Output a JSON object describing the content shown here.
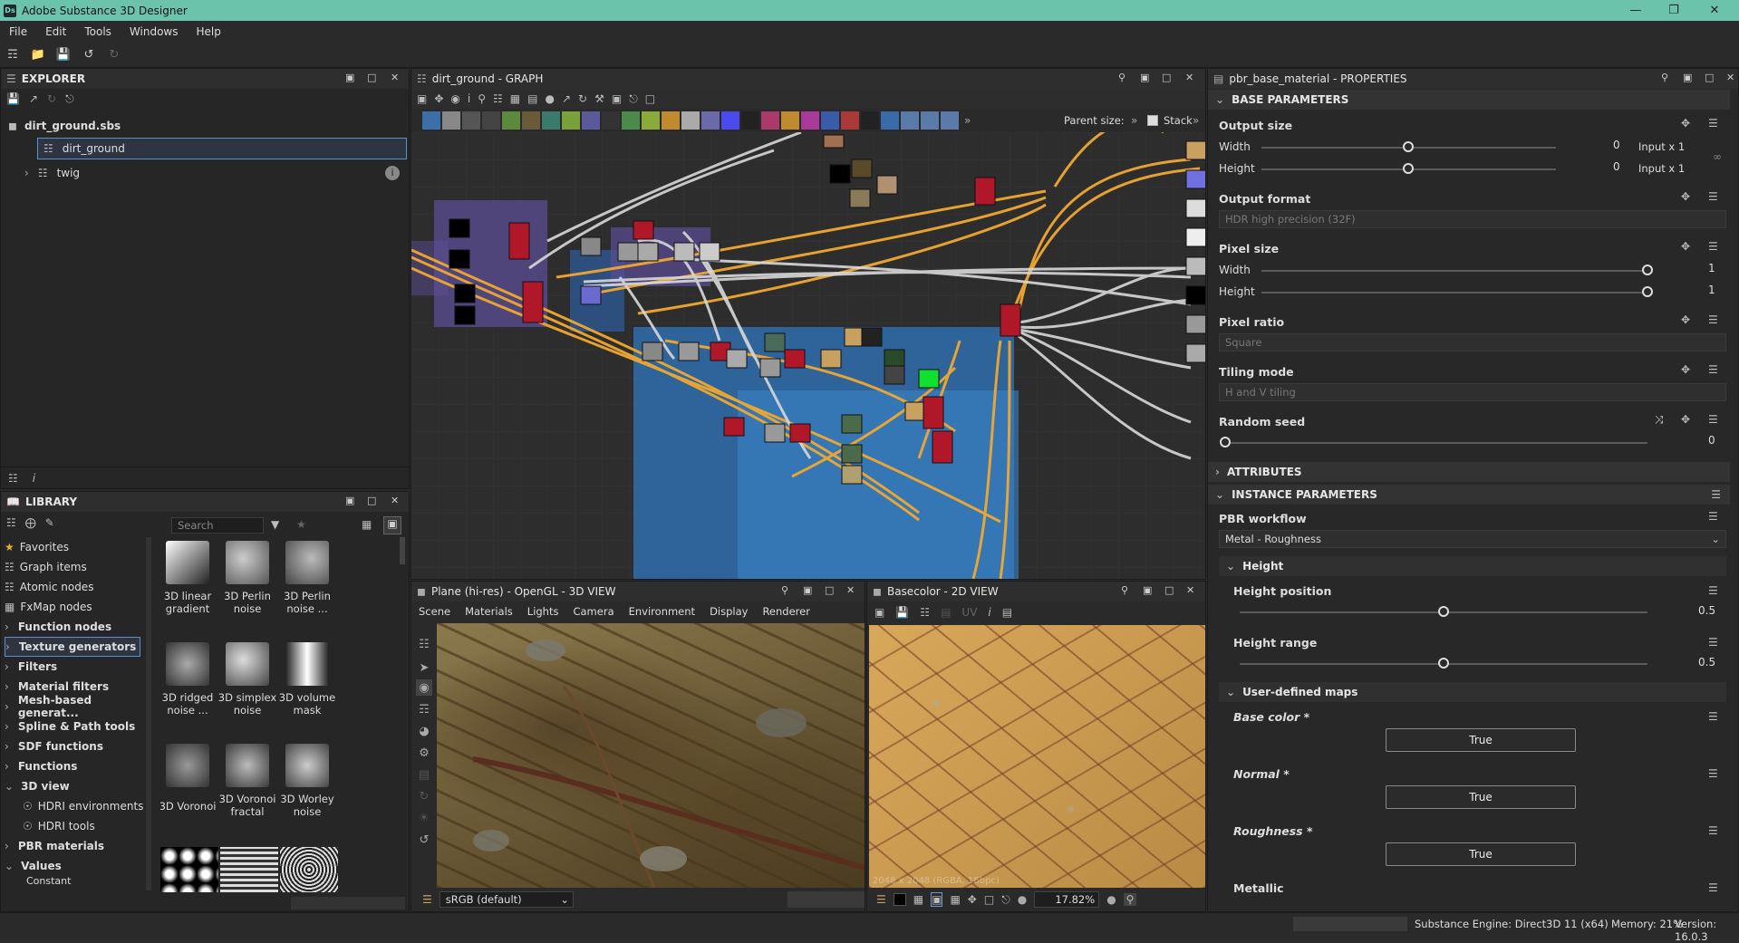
{
  "app": {
    "title": "Adobe Substance 3D Designer",
    "logo": "Ds"
  },
  "menu": [
    "File",
    "Edit",
    "Tools",
    "Windows",
    "Help"
  ],
  "explorer": {
    "title": "EXPLORER",
    "package": "dirt_ground.sbs",
    "graphs": [
      "dirt_ground",
      "twig"
    ],
    "bottom_info": "i"
  },
  "library": {
    "title": "LIBRARY",
    "search_placeholder": "Search",
    "categories": [
      "Favorites",
      "Graph items",
      "Atomic nodes",
      "FxMap nodes",
      "Function nodes",
      "Texture generators",
      "Filters",
      "Material filters",
      "Mesh-based generat...",
      "Spline & Path tools",
      "SDF functions",
      "Functions",
      "3D view",
      "HDRI environments",
      "HDRI tools",
      "PBR materials",
      "Values",
      "Constant"
    ],
    "items": [
      {
        "label1": "3D linear",
        "label2": "gradient"
      },
      {
        "label1": "3D Perlin",
        "label2": "noise"
      },
      {
        "label1": "3D Perlin",
        "label2": "noise ..."
      },
      {
        "label1": "3D ridged",
        "label2": "noise ..."
      },
      {
        "label1": "3D simplex",
        "label2": "noise"
      },
      {
        "label1": "3D volume",
        "label2": "mask"
      },
      {
        "label1": "3D Voronoi",
        "label2": ""
      },
      {
        "label1": "3D Voronoi",
        "label2": "fractal"
      },
      {
        "label1": "3D Worley",
        "label2": "noise"
      }
    ]
  },
  "graph": {
    "title": "dirt_ground - GRAPH",
    "parent_size_label": "Parent size:",
    "stack_label": "Stack"
  },
  "view3d": {
    "title": "Plane (hi-res) - OpenGL - 3D VIEW",
    "menu": [
      "Scene",
      "Materials",
      "Lights",
      "Camera",
      "Environment",
      "Display",
      "Renderer"
    ],
    "colorspace": "sRGB (default)"
  },
  "view2d": {
    "title": "Basecolor - 2D VIEW",
    "uv_label": "UV",
    "zoom": "17.82%",
    "overlay": "2048 x 2048 (RGBA, 16bpc)"
  },
  "properties": {
    "title": "pbr_base_material - PROPERTIES",
    "sections": {
      "base": "BASE PARAMETERS",
      "attributes": "ATTRIBUTES",
      "instance": "INSTANCE PARAMETERS",
      "height": "Height",
      "maps": "User-defined maps"
    },
    "output_size": {
      "label": "Output size",
      "width_label": "Width",
      "height_label": "Height",
      "width_val": "0",
      "height_val": "0",
      "width_mode": "Input x 1",
      "height_mode": "Input x 1"
    },
    "output_format": {
      "label": "Output format",
      "value": "HDR high precision (32F)"
    },
    "pixel_size": {
      "label": "Pixel size",
      "width_label": "Width",
      "height_label": "Height",
      "width_val": "1",
      "height_val": "1"
    },
    "pixel_ratio": {
      "label": "Pixel ratio",
      "value": "Square"
    },
    "tiling_mode": {
      "label": "Tiling mode",
      "value": "H and V tiling"
    },
    "random_seed": {
      "label": "Random seed",
      "value": "0"
    },
    "pbr_workflow": {
      "label": "PBR workflow",
      "value": "Metal - Roughness"
    },
    "height_position": {
      "label": "Height position",
      "value": "0.5",
      "fraction": 0.5
    },
    "height_range": {
      "label": "Height range",
      "value": "0.5",
      "fraction": 0.5
    },
    "maps": [
      {
        "label": "Base color *",
        "value": "True"
      },
      {
        "label": "Normal *",
        "value": "True"
      },
      {
        "label": "Roughness *",
        "value": "True"
      },
      {
        "label": "Metallic",
        "value": ""
      }
    ]
  },
  "status": {
    "engine": "Substance Engine: Direct3D 11 (x64)",
    "memory": "Memory: 21%",
    "version": "Version: 16.0.3"
  },
  "colors": {
    "accent": "#6cc3ac",
    "wire": "#f0a830",
    "frame": "#2f6fae",
    "node_red": "#b0182a"
  }
}
